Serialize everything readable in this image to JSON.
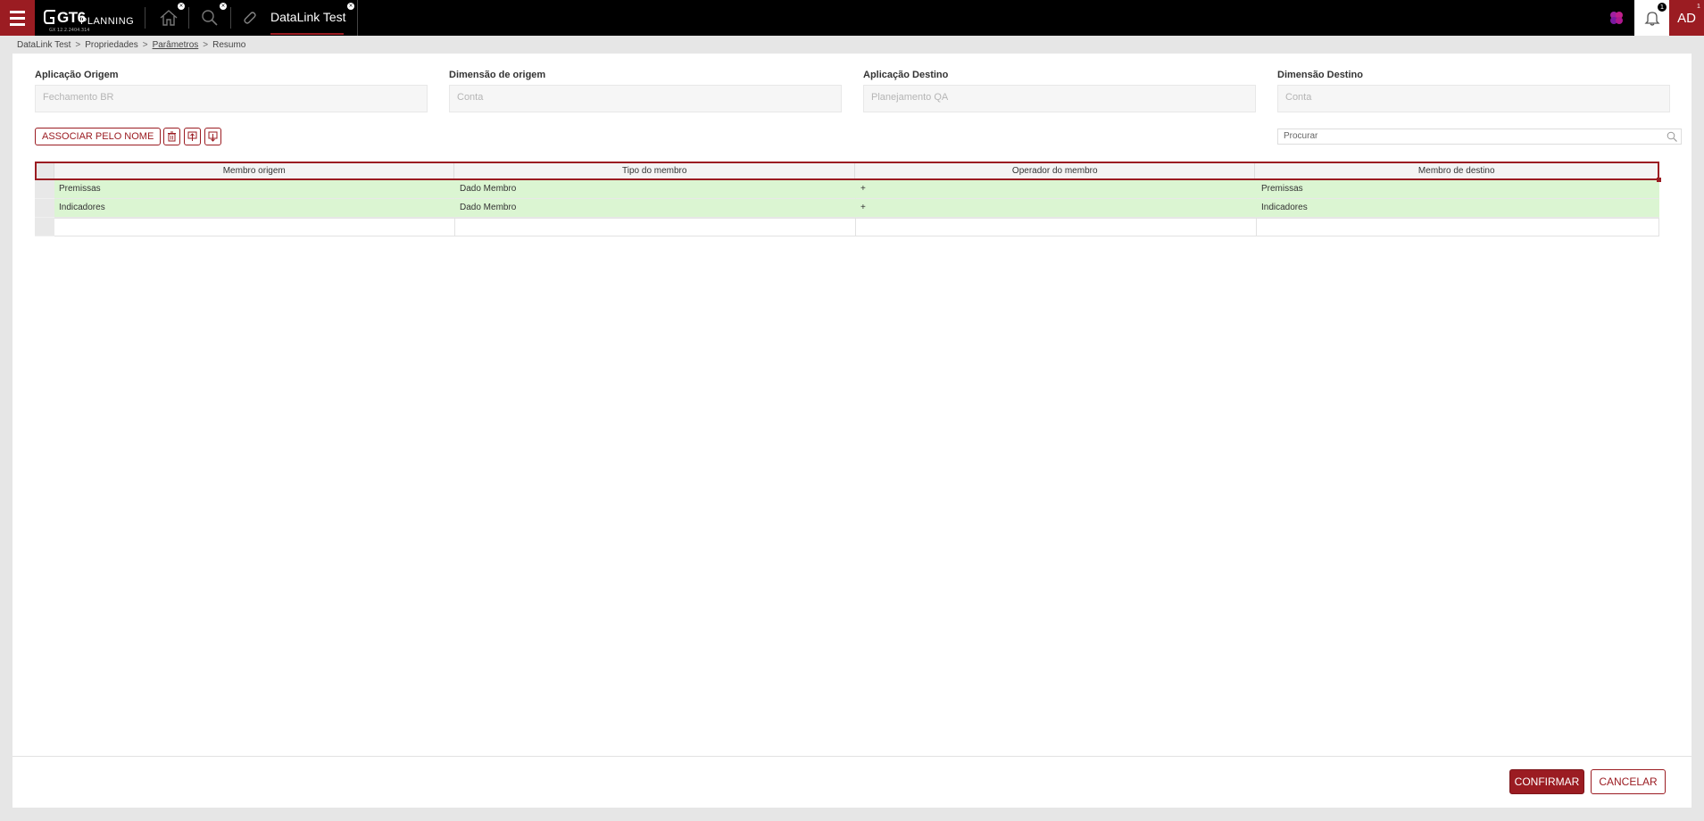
{
  "topbar": {
    "logo": {
      "brand": "GT6",
      "product": "PLANNING",
      "version": "GX 12.2.2404.314"
    },
    "tabs": [
      {
        "name": "home",
        "icon": "home-icon"
      },
      {
        "name": "search",
        "icon": "search-icon"
      },
      {
        "name": "datalink",
        "icon": "paperclip-icon",
        "title": "DataLink Test",
        "active": true
      }
    ],
    "notifications_count": "1",
    "user_initials": "AD",
    "user_badge": "1",
    "colors": {
      "brand": "#9b1c22",
      "bar": "#000000"
    }
  },
  "breadcrumb": [
    {
      "label": "DataLink Test"
    },
    {
      "label": "Propriedades"
    },
    {
      "label": "Parâmetros"
    },
    {
      "label": "Resumo"
    }
  ],
  "breadcrumb_separator": ">",
  "form": {
    "source_app": {
      "label": "Aplicação Origem",
      "value": "Fechamento BR"
    },
    "source_dim": {
      "label": "Dimensão de origem",
      "value": "Conta"
    },
    "target_app": {
      "label": "Aplicação Destino",
      "value": "Planejamento QA"
    },
    "target_dim": {
      "label": "Dimensão Destino",
      "value": "Conta"
    }
  },
  "toolbar": {
    "associate_label": "ASSOCIAR PELO NOME",
    "search_placeholder": "Procurar"
  },
  "grid": {
    "columns": [
      "Membro origem",
      "Tipo do membro",
      "Operador do membro",
      "Membro de destino"
    ],
    "rows": [
      [
        "Premissas",
        "Dado Membro",
        "+",
        "Premissas"
      ],
      [
        "Indicadores",
        "Dado Membro",
        "+",
        "Indicadores"
      ]
    ],
    "row_color": "#dbf5d2"
  },
  "footer": {
    "confirm_label": "CONFIRMAR",
    "cancel_label": "CANCELAR"
  }
}
